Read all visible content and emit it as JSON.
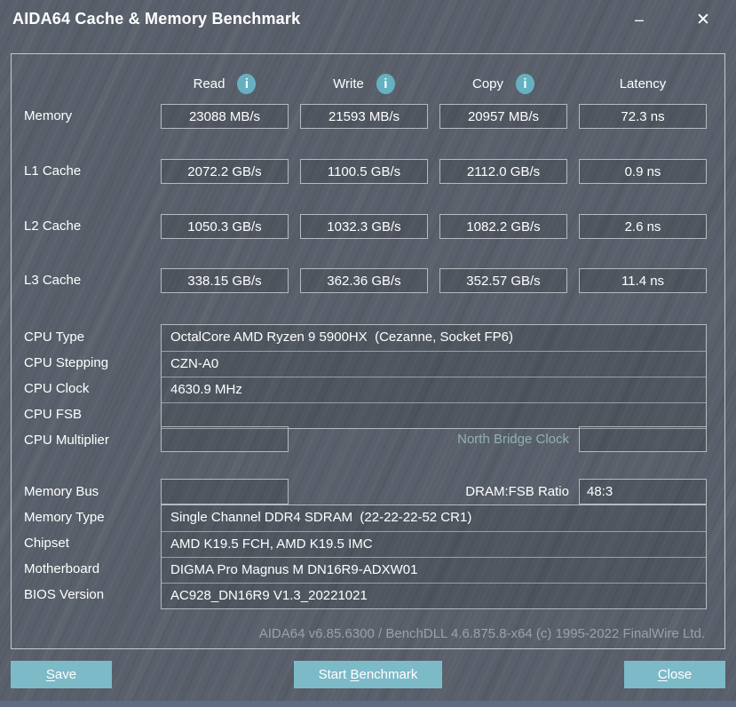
{
  "window": {
    "title": "AIDA64 Cache & Memory Benchmark",
    "minimize_glyph": "–",
    "close_glyph": "✕"
  },
  "colors": {
    "background": "#59606b",
    "panel_border": "#c6c9cd",
    "box_border": "#b6bac0",
    "accent_teal": "#7dbac8",
    "info_icon_teal": "#66b1c1",
    "north_bridge_label": "#90b2ae",
    "footer_text": "#9ba1ab",
    "bottom_strip": "#5d6c80"
  },
  "icons": {
    "info_glyph": "i"
  },
  "bench": {
    "columns": {
      "read": "Read",
      "write": "Write",
      "copy": "Copy",
      "latency": "Latency"
    },
    "rows": [
      {
        "label": "Memory",
        "read": "23088 MB/s",
        "write": "21593 MB/s",
        "copy": "20957 MB/s",
        "latency": "72.3 ns"
      },
      {
        "label": "L1 Cache",
        "read": "2072.2 GB/s",
        "write": "1100.5 GB/s",
        "copy": "2112.0 GB/s",
        "latency": "0.9 ns"
      },
      {
        "label": "L2 Cache",
        "read": "1050.3 GB/s",
        "write": "1032.3 GB/s",
        "copy": "1082.2 GB/s",
        "latency": "2.6 ns"
      },
      {
        "label": "L3 Cache",
        "read": "338.15 GB/s",
        "write": "362.36 GB/s",
        "copy": "352.57 GB/s",
        "latency": "11.4 ns"
      }
    ]
  },
  "cpu": {
    "rows": [
      {
        "label": "CPU Type",
        "value": "OctalCore AMD Ryzen 9 5900HX  (Cezanne, Socket FP6)"
      },
      {
        "label": "CPU Stepping",
        "value": "CZN-A0"
      },
      {
        "label": "CPU Clock",
        "value": "4630.9 MHz"
      },
      {
        "label": "CPU FSB",
        "value": ""
      }
    ],
    "multiplier": {
      "label": "CPU Multiplier",
      "value": "",
      "north_bridge_label": "North Bridge Clock",
      "north_bridge_value": ""
    }
  },
  "memory": {
    "bus": {
      "label": "Memory Bus",
      "value": "",
      "ratio_label": "DRAM:FSB Ratio",
      "ratio_value": "48:3"
    },
    "rows": [
      {
        "label": "Memory Type",
        "value": "Single Channel DDR4 SDRAM  (22-22-22-52 CR1)"
      },
      {
        "label": "Chipset",
        "value": "AMD K19.5 FCH, AMD K19.5 IMC"
      },
      {
        "label": "Motherboard",
        "value": "DIGMA Pro Magnus M DN16R9-ADXW01"
      },
      {
        "label": "BIOS Version",
        "value": "AC928_DN16R9 V1.3_20221021"
      }
    ]
  },
  "footer": "AIDA64 v6.85.6300 / BenchDLL 4.6.875.8-x64  (c) 1995-2022 FinalWire Ltd.",
  "buttons": {
    "save": {
      "pre": "",
      "key": "S",
      "post": "ave"
    },
    "start": {
      "pre": "Start ",
      "key": "B",
      "post": "enchmark"
    },
    "close": {
      "pre": "",
      "key": "C",
      "post": "lose"
    }
  }
}
